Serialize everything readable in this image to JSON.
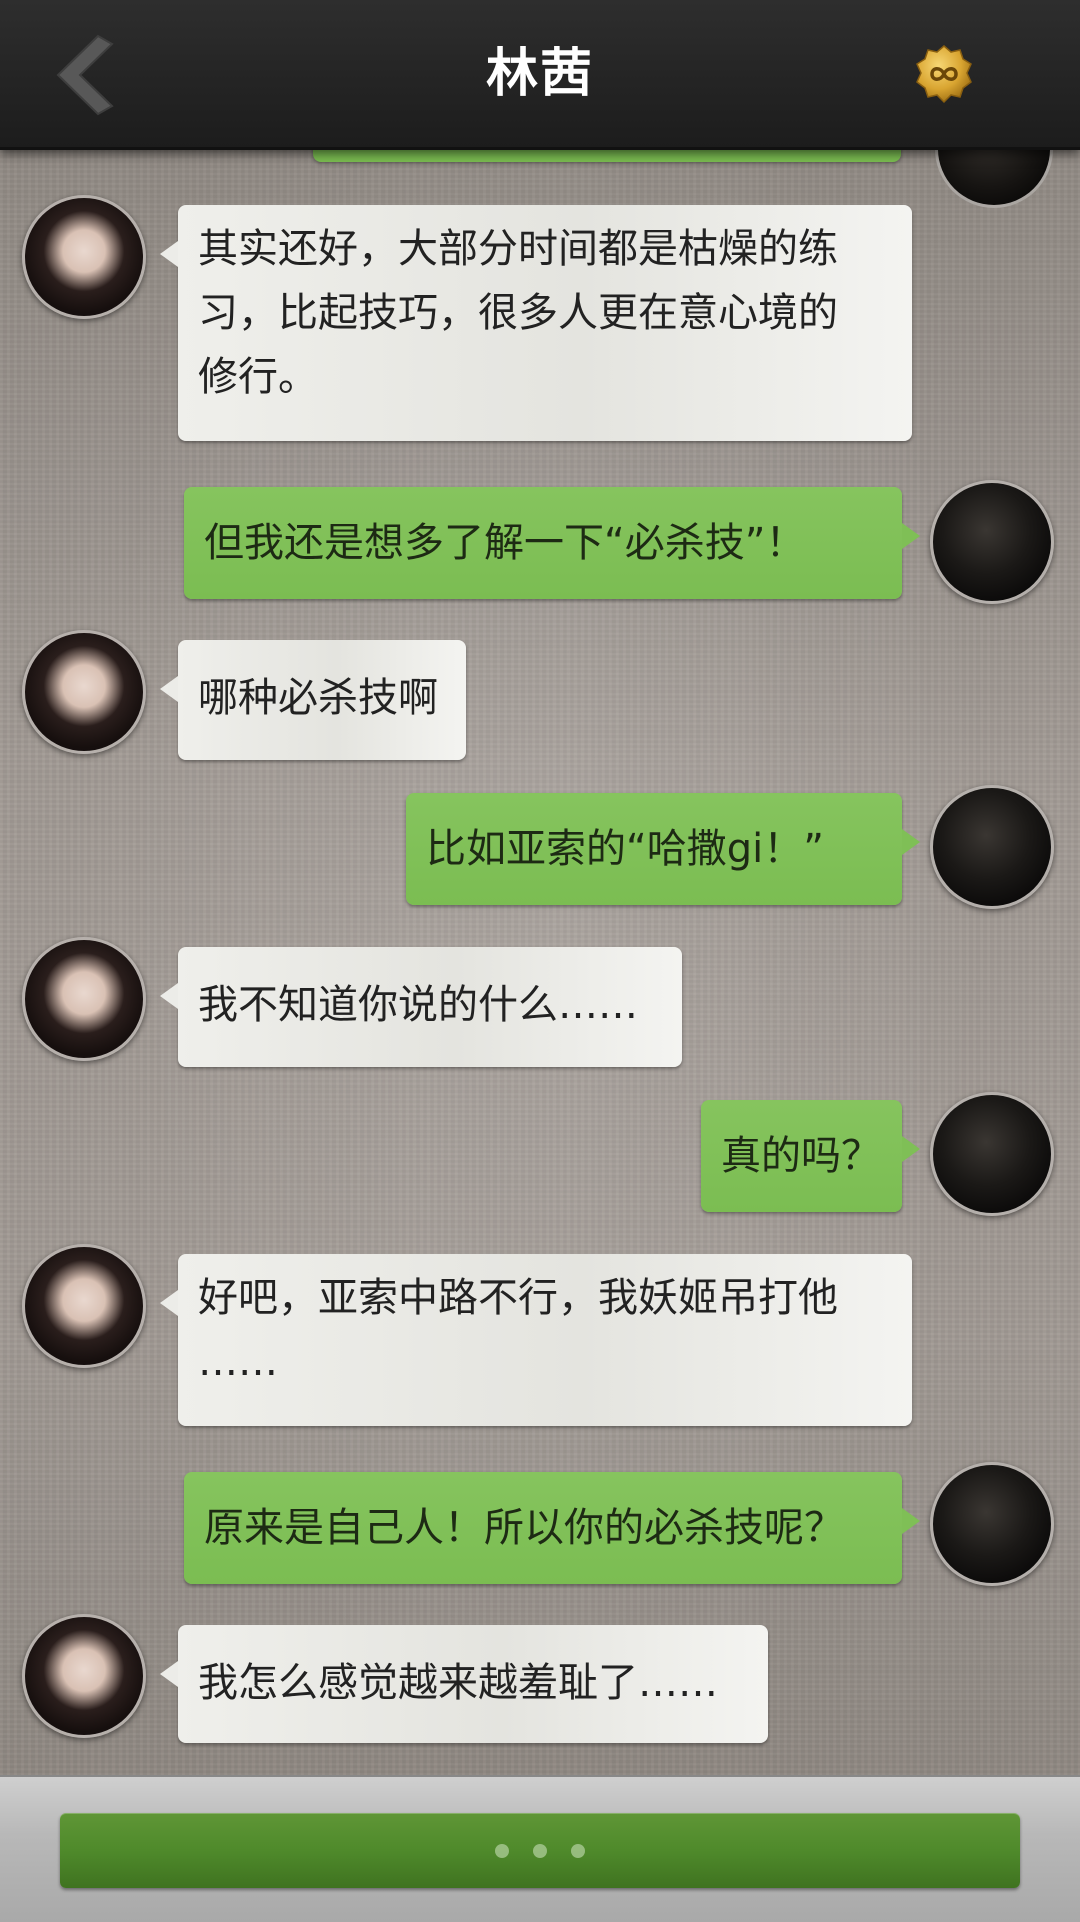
{
  "header": {
    "title": "林茜",
    "back_icon": "chevron-left-icon",
    "badge_icon": "infinity-icon"
  },
  "messages": [
    {
      "sender": "contact",
      "text": "其实还好，大部分时间都是枯燥的练\n习，比起技巧，很多人更在意心境的\n修行。"
    },
    {
      "sender": "me",
      "text": "但我还是想多了解一下“必杀技”！"
    },
    {
      "sender": "contact",
      "text": "哪种必杀技啊"
    },
    {
      "sender": "me",
      "text": "比如亚索的“哈撒gi！”"
    },
    {
      "sender": "contact",
      "text": "我不知道你说的什么……"
    },
    {
      "sender": "me",
      "text": "真的吗？"
    },
    {
      "sender": "contact",
      "text": "好吧，亚索中路不行，我妖姬吊打他\n……"
    },
    {
      "sender": "me",
      "text": "原来是自己人！所以你的必杀技呢？"
    },
    {
      "sender": "contact",
      "text": "我怎么感觉越来越羞耻了……"
    }
  ],
  "bottom": {
    "choice_indicator": "typing-dots-icon"
  },
  "colors": {
    "header_bg": "#242424",
    "incoming_bubble": "#ecece8",
    "outgoing_bubble": "#7fbf56",
    "choice_button": "#4f8a2b",
    "badge_gold": "#d9a531"
  }
}
